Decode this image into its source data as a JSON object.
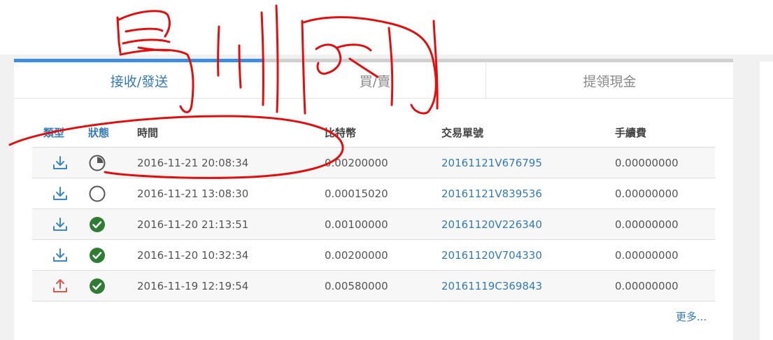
{
  "tabs": {
    "receive_send": "接收/發送",
    "buy_sell": "買/賣",
    "withdraw_cash": "提領現金"
  },
  "columns": {
    "type": "類型",
    "status": "狀態",
    "time": "時間",
    "bitcoin": "比特幣",
    "tx_id": "交易單號",
    "fee": "手續費"
  },
  "rows": [
    {
      "type": "download-icon",
      "status": "pending-clock-icon",
      "time": "2016-11-21 20:08:34",
      "bitcoin": "0.00200000",
      "tx_id": "20161121V676795",
      "fee": "0.00000000"
    },
    {
      "type": "download-icon",
      "status": "empty-circle-icon",
      "time": "2016-11-21 13:08:30",
      "bitcoin": "0.00015020",
      "tx_id": "20161121V839536",
      "fee": "0.00000000"
    },
    {
      "type": "download-icon",
      "status": "check-circle-icon",
      "time": "2016-11-20 21:13:51",
      "bitcoin": "0.00100000",
      "tx_id": "20161120V226340",
      "fee": "0.00000000"
    },
    {
      "type": "download-icon",
      "status": "check-circle-icon",
      "time": "2016-11-20 10:32:34",
      "bitcoin": "0.00200000",
      "tx_id": "20161120V704330",
      "fee": "0.00000000"
    },
    {
      "type": "upload-icon",
      "status": "check-circle-icon",
      "time": "2016-11-19 12:19:54",
      "bitcoin": "0.00580000",
      "tx_id": "20161119C369843",
      "fee": "0.00000000"
    }
  ],
  "more_link": "更多...",
  "colors": {
    "accent": "#337ab7",
    "active_tab_bar": "#3c8de0",
    "inactive_tab_bar": "#cfcfcf",
    "receive_icon": "#3a86cc",
    "send_icon": "#e0554f",
    "success": "#2e7d32",
    "annotation": "#e01010"
  }
}
